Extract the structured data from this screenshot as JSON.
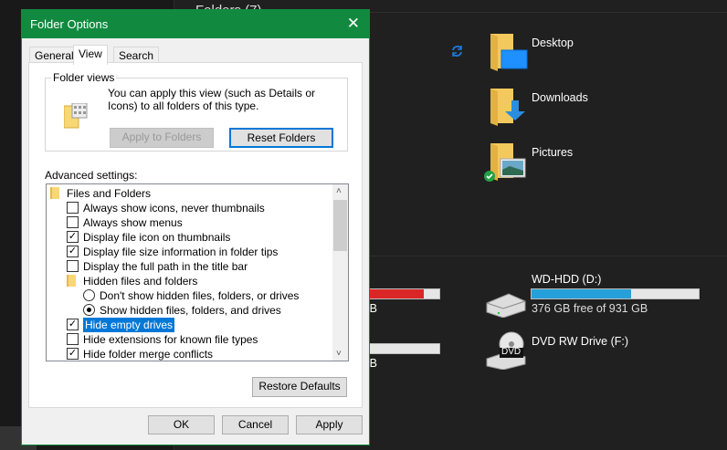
{
  "explorer": {
    "header": "Folders (7)",
    "folders": [
      {
        "name": "Desktop"
      },
      {
        "name": "Downloads"
      },
      {
        "name": "Pictures"
      }
    ],
    "drives": [
      {
        "name": "WD-HDD (D:)",
        "free": "376 GB free of 931 GB",
        "used_fraction": 0.596
      },
      {
        "name": "DVD RW Drive (F:)",
        "badge": "DVD"
      }
    ],
    "partial_drives": [
      {
        "text": "B",
        "used_fraction": 0.78,
        "color": "#d92b2b"
      },
      {
        "text": "B",
        "used_fraction": 0.0,
        "color": "#e6e6e6"
      }
    ],
    "colors": {
      "bar_blue": "#26a0da",
      "bar_red": "#da2626",
      "accent": "#118a3f"
    }
  },
  "dialog": {
    "title": "Folder Options",
    "tabs": [
      "General",
      "View",
      "Search"
    ],
    "active_tab": "View",
    "folder_views": {
      "label": "Folder views",
      "description": "You can apply this view (such as Details or Icons) to all folders of this type.",
      "apply_button": "Apply to Folders",
      "reset_button": "Reset Folders"
    },
    "advanced_label": "Advanced settings:",
    "settings": [
      {
        "type": "folder",
        "label": "Files and Folders",
        "indent": 0
      },
      {
        "type": "checkbox",
        "label": "Always show icons, never thumbnails",
        "checked": false,
        "indent": 1
      },
      {
        "type": "checkbox",
        "label": "Always show menus",
        "checked": false,
        "indent": 1
      },
      {
        "type": "checkbox",
        "label": "Display file icon on thumbnails",
        "checked": true,
        "indent": 1
      },
      {
        "type": "checkbox",
        "label": "Display file size information in folder tips",
        "checked": true,
        "indent": 1
      },
      {
        "type": "checkbox",
        "label": "Display the full path in the title bar",
        "checked": false,
        "indent": 1
      },
      {
        "type": "folder",
        "label": "Hidden files and folders",
        "indent": 1
      },
      {
        "type": "radio",
        "label": "Don't show hidden files, folders, or drives",
        "checked": false,
        "indent": 2
      },
      {
        "type": "radio",
        "label": "Show hidden files, folders, and drives",
        "checked": true,
        "indent": 2
      },
      {
        "type": "checkbox",
        "label": "Hide empty drives",
        "checked": true,
        "indent": 1,
        "selected": true
      },
      {
        "type": "checkbox",
        "label": "Hide extensions for known file types",
        "checked": false,
        "indent": 1
      },
      {
        "type": "checkbox",
        "label": "Hide folder merge conflicts",
        "checked": true,
        "indent": 1
      }
    ],
    "restore_button": "Restore Defaults",
    "ok": "OK",
    "cancel": "Cancel",
    "apply": "Apply"
  }
}
